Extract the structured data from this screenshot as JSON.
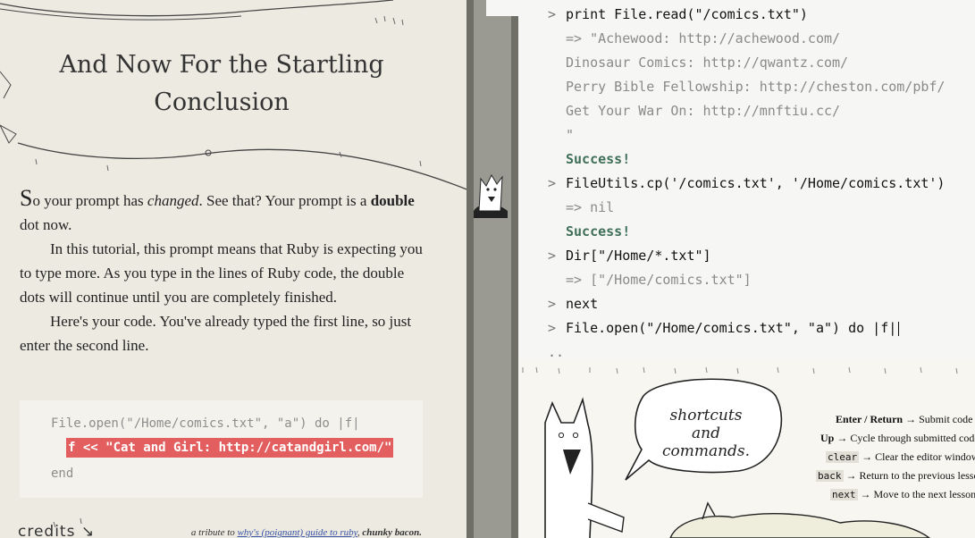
{
  "lesson": {
    "title_line1": "And Now For the Startling",
    "title_line2": "Conclusion",
    "p1_dropcap": "S",
    "p1_a": "o your prompt has ",
    "p1_em": "changed",
    "p1_b": ". See that? Your prompt is a ",
    "p1_strong": "double",
    "p1_c": " dot now.",
    "p2": "In this tutorial, this prompt means that Ruby is expecting you to type more. As you type in the lines of Ruby code, the double dots will continue until you are completely finished.",
    "p3": "Here's your code. You've already typed the first line, so just enter the second line.",
    "code_line1": "File.open(\"/Home/comics.txt\", \"a\") do |f|",
    "code_line2": "f << \"Cat and Girl: http://catandgirl.com/\"",
    "code_line3": "end",
    "credits": "credits",
    "tribute_pre": "a tribute to ",
    "tribute_link": "why's (poignant) guide to ruby",
    "tribute_sep": ", ",
    "tribute_bold": "chunky bacon."
  },
  "terminal": {
    "prompt": ">",
    "cont_prompt": "..",
    "lines": [
      {
        "kind": "cmd",
        "text": "print File.read(\"/comics.txt\")"
      },
      {
        "kind": "out",
        "text": "=> \"Achewood: http://achewood.com/"
      },
      {
        "kind": "out",
        "text": "Dinosaur Comics: http://qwantz.com/"
      },
      {
        "kind": "out",
        "text": "Perry Bible Fellowship: http://cheston.com/pbf/"
      },
      {
        "kind": "out",
        "text": "Get Your War On: http://mnftiu.cc/"
      },
      {
        "kind": "out",
        "text": "\""
      },
      {
        "kind": "ok",
        "text": "Success!"
      },
      {
        "kind": "cmd",
        "text": "FileUtils.cp('/comics.txt', '/Home/comics.txt')"
      },
      {
        "kind": "out",
        "text": "=> nil"
      },
      {
        "kind": "ok",
        "text": "Success!"
      },
      {
        "kind": "cmd",
        "text": "Dir[\"/Home/*.txt\"]"
      },
      {
        "kind": "out",
        "text": "=> [\"/Home/comics.txt\"]"
      },
      {
        "kind": "cmd",
        "text": "next"
      },
      {
        "kind": "cmd",
        "text": "File.open(\"/Home/comics.txt\", \"a\") do |f|"
      }
    ]
  },
  "help": {
    "speech_1": "shortcuts",
    "speech_2": "and",
    "speech_3": "commands.",
    "shortcuts": [
      {
        "key": "Enter / Return",
        "desc": " → Submit code",
        "code": false
      },
      {
        "key": "Up",
        "desc": " → Cycle through submitted code",
        "code": false
      },
      {
        "key": "clear",
        "desc": " → Clear the editor window",
        "code": true
      },
      {
        "key": "back",
        "desc": " → Return to the previous lesson",
        "code": true
      },
      {
        "key": "next",
        "desc": " → Move to the next lesson",
        "code": true
      }
    ]
  }
}
